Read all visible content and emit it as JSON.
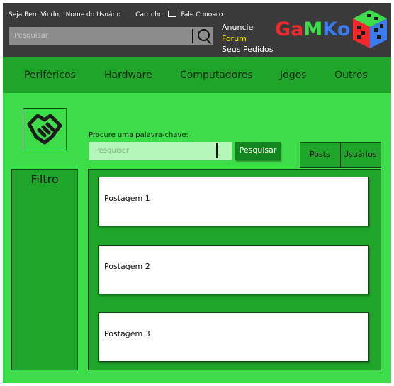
{
  "header": {
    "welcome": "Seja Bem Vindo,",
    "username": "Nome do Usuário",
    "cart": "Carrinho",
    "contact": "Fale Conosco",
    "search_placeholder": "Pesquisar",
    "links": [
      "Anuncie",
      "Forum",
      "Seus Pedidos"
    ],
    "logo": [
      "G",
      "a",
      "M",
      "K",
      "o"
    ]
  },
  "nav": {
    "items": [
      "Periféricos",
      "Hardware",
      "Computadores",
      "Jogos",
      "Outros"
    ]
  },
  "search": {
    "label": "Procure uma palavra-chave:",
    "placeholder": "Pesquisar",
    "button": "Pesquisar"
  },
  "tabs": [
    "Posts",
    "Usuários"
  ],
  "filter": {
    "title": "Filtro"
  },
  "posts": [
    "Postagem 1",
    "Postagem 2",
    "Postagem 3"
  ],
  "colors": {
    "header_bg": "#3a3a3a",
    "nav_bg": "#1fa52a",
    "page_bg": "#3ddd4a",
    "highlight_link": "#f2e400"
  }
}
